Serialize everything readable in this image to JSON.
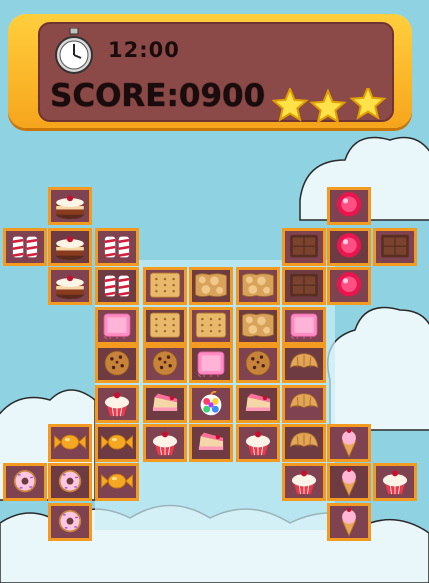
{
  "hud": {
    "time": "12:00",
    "score_label": "SCORE:",
    "score_value": "0900",
    "stars_earned": 3,
    "stars_total": 3,
    "timer_icon": "stopwatch-icon"
  },
  "board": {
    "colors": {
      "border": "#f39a20",
      "cell_dark": "#6e3b43",
      "cell_light": "#7f4250"
    },
    "rows": [
      [
        null,
        "cake",
        null,
        null,
        null,
        null,
        null,
        "jelly",
        null
      ],
      [
        "peppermint",
        "cake",
        "peppermint",
        null,
        null,
        null,
        "chocolate",
        "jelly",
        "chocolate"
      ],
      [
        null,
        "cake",
        "peppermint",
        "cracker",
        "cookie-chunk",
        "cookie-chunk",
        "chocolate",
        "jelly",
        null
      ],
      [
        null,
        null,
        "pink-candy",
        "cracker",
        "cracker",
        "cookie-chunk",
        "pink-candy",
        null,
        null
      ],
      [
        null,
        null,
        "choc-chip-cookie",
        "choc-chip-cookie",
        "pink-candy",
        "choc-chip-cookie",
        "croissant",
        null,
        null
      ],
      [
        null,
        null,
        "cupcake",
        "cake-slice",
        "rainbow-bomb",
        "cake-slice",
        "croissant",
        null,
        null
      ],
      [
        null,
        "wrapped-candy",
        "wrapped-candy",
        "cupcake",
        "cake-slice",
        "cupcake",
        "croissant",
        "ice-cream",
        null
      ],
      [
        "donut",
        "donut",
        "wrapped-candy",
        null,
        null,
        null,
        "cupcake",
        "ice-cream",
        "cupcake"
      ],
      [
        null,
        "donut",
        null,
        null,
        null,
        null,
        null,
        "ice-cream",
        null
      ]
    ]
  }
}
